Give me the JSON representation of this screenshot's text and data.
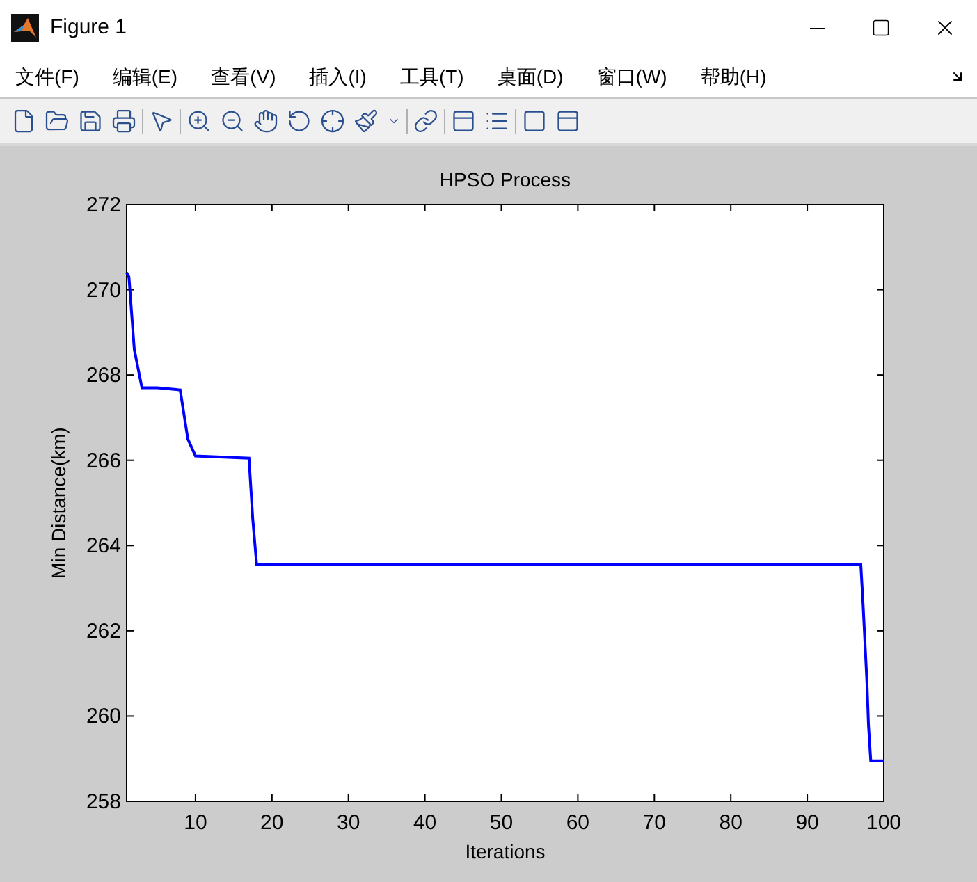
{
  "window": {
    "title": "Figure 1"
  },
  "menu": [
    {
      "label": "文件(F)"
    },
    {
      "label": "编辑(E)"
    },
    {
      "label": "查看(V)"
    },
    {
      "label": "插入(I)"
    },
    {
      "label": "工具(T)"
    },
    {
      "label": "桌面(D)"
    },
    {
      "label": "窗口(W)"
    },
    {
      "label": "帮助(H)"
    }
  ],
  "figure": {
    "chart_data": {
      "type": "line",
      "title": "HPSO Process",
      "xlabel": "Iterations",
      "ylabel": "Min Distance(km)",
      "x": [
        1,
        1.3,
        2,
        3,
        5,
        8,
        9,
        10,
        17,
        17.5,
        18,
        97,
        97.3,
        97.8,
        98,
        98.3,
        100
      ],
      "series": [
        {
          "color": "#0000ff",
          "values": [
            270.4,
            270.3,
            268.6,
            267.7,
            267.7,
            267.65,
            266.5,
            266.1,
            266.05,
            264.6,
            263.55,
            263.55,
            262.6,
            260.8,
            259.8,
            258.95,
            258.95
          ]
        }
      ],
      "xlim": [
        1,
        100
      ],
      "ylim": [
        258,
        272
      ],
      "xticks": [
        10,
        20,
        30,
        40,
        50,
        60,
        70,
        80,
        90,
        100
      ],
      "yticks": [
        258,
        260,
        262,
        264,
        266,
        268,
        270,
        272
      ]
    }
  }
}
